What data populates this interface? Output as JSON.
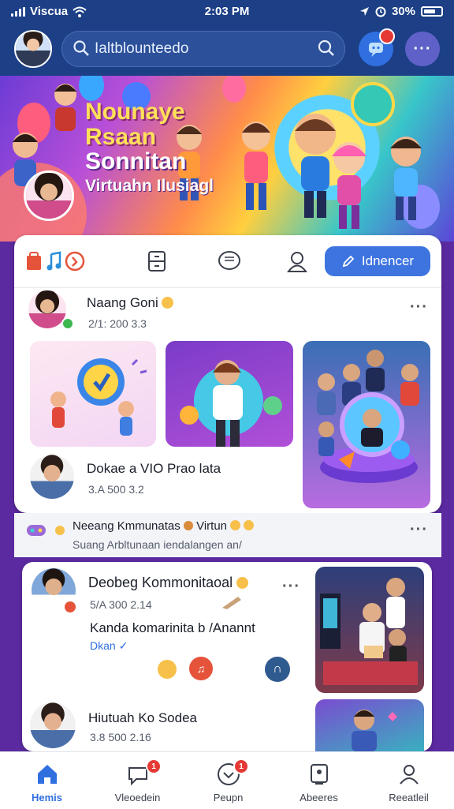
{
  "status_bar": {
    "carrier": "Viscua",
    "time": "2:03 PM",
    "battery": "30%"
  },
  "top_bar": {
    "search_placeholder": "Ialtblounteedo"
  },
  "banner": {
    "line1": "Nounaye",
    "line2": "Rsaan",
    "line3": "Sonnitan",
    "line4": "Virtuahn Ilusiagl"
  },
  "toolbar": {
    "primary_button_label": "Idnencer"
  },
  "posts": [
    {
      "name": "Naang Goni",
      "meta": "2/1: 200 3.3"
    },
    {
      "name": "Dokae a VIO Prao lata",
      "meta": "3.A 500 3.2"
    }
  ],
  "activity": {
    "title": "Neeang Kmmunatas",
    "suffix": "Virtun",
    "subtitle": "Suang Arbltunaan iendalangen an/"
  },
  "feature_card": {
    "name": "Deobeg Kommonitaoal",
    "meta": "5/A 300 2.14",
    "headline": "Kanda komarinita b /Anannt",
    "tag": "Dkan"
  },
  "bottom_post": {
    "name": "Hiutuah Ko Sodea",
    "meta": "3.8 500 2.16"
  },
  "tabs": [
    {
      "label": "Hemis",
      "icon": "home-icon",
      "active": true
    },
    {
      "label": "Vleoedein",
      "icon": "speech-bubble-icon",
      "badge": "1"
    },
    {
      "label": "Peupn",
      "icon": "heart-message-icon",
      "badge": "1"
    },
    {
      "label": "Abeeres",
      "icon": "profile-card-icon"
    },
    {
      "label": "Reeatleil",
      "icon": "person-icon"
    }
  ],
  "colors": {
    "header": "#1c3f86",
    "accent": "#3e74e0",
    "badge": "#e53935"
  }
}
